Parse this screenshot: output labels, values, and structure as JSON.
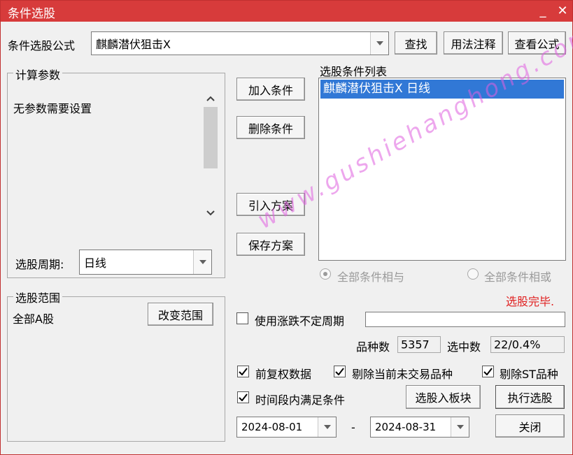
{
  "window": {
    "title": "条件选股",
    "minimize_glyph": "_",
    "close_glyph": "✕"
  },
  "formula": {
    "label": "条件选股公式",
    "value": "麒麟潜伏狙击X",
    "find_label": "查找",
    "usage_label": "用法注释",
    "view_label": "查看公式"
  },
  "params": {
    "group_title": "计算参数",
    "message": "无参数需要设置",
    "period_label": "选股周期:",
    "period_value": "日线"
  },
  "range": {
    "group_title": "选股范围",
    "value": "全部A股",
    "change_label": "改变范围"
  },
  "actions": {
    "add": "加入条件",
    "delete": "删除条件",
    "import": "引入方案",
    "save": "保存方案"
  },
  "conditions": {
    "title": "选股条件列表",
    "items": [
      "麒麟潜伏狙击X  日线"
    ],
    "and_label": "全部条件相与",
    "or_label": "全部条件相或",
    "status": "选股完毕."
  },
  "options": {
    "uncertain_period_label": "使用涨跌不定周期",
    "uncertain_period_checked": false,
    "count_label": "品种数",
    "count_value": "5357",
    "selected_label": "选中数",
    "selected_value": "22/0.4%",
    "forward_adjust_label": "前复权数据",
    "forward_adjust_checked": true,
    "exclude_untraded_label": "剔除当前未交易品种",
    "exclude_untraded_checked": true,
    "exclude_st_label": "剔除ST品种",
    "exclude_st_checked": true,
    "period_satisfy_label": "时间段内满足条件",
    "period_satisfy_checked": true,
    "date_start": "2024-08-01",
    "date_sep": "-",
    "date_end": "2024-08-31"
  },
  "buttons": {
    "to_block": "选股入板块",
    "execute": "执行选股",
    "close": "关闭"
  },
  "watermark": "www.gushiehanghong.com",
  "colors": {
    "titlebar": "#d73b3b",
    "selection": "#3178d6",
    "status": "#e02020",
    "watermark": "#e060e0"
  }
}
